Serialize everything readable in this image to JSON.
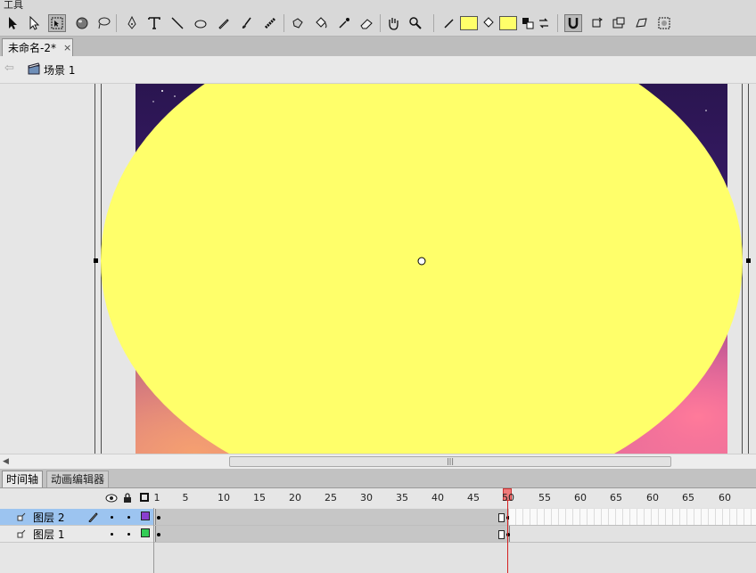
{
  "toolbar": {
    "title": "工具",
    "tools": [
      {
        "name": "selection-tool",
        "icon": "arrow-icon"
      },
      {
        "name": "subselection-tool",
        "icon": "white-arrow-icon"
      },
      {
        "name": "free-transform-tool",
        "icon": "free-transform-icon"
      },
      {
        "name": "3d-rotation-tool",
        "icon": "sphere-icon"
      },
      {
        "name": "lasso-tool",
        "icon": "lasso-icon"
      },
      {
        "name": "pen-tool",
        "icon": "pen-icon"
      },
      {
        "name": "text-tool",
        "icon": "text-icon"
      },
      {
        "name": "line-tool",
        "icon": "line-icon"
      },
      {
        "name": "oval-tool",
        "icon": "oval-icon"
      },
      {
        "name": "pencil-tool",
        "icon": "pencil-icon"
      },
      {
        "name": "brush-tool",
        "icon": "brush-icon"
      },
      {
        "name": "deco-tool",
        "icon": "deco-icon"
      },
      {
        "name": "bone-tool",
        "icon": "bone-icon"
      },
      {
        "name": "paint-bucket-tool",
        "icon": "bucket-icon"
      },
      {
        "name": "eyedropper-tool",
        "icon": "eyedropper-icon"
      },
      {
        "name": "eraser-tool",
        "icon": "eraser-icon"
      },
      {
        "name": "hand-tool",
        "icon": "hand-icon"
      },
      {
        "name": "zoom-tool",
        "icon": "magnifier-icon"
      }
    ],
    "stroke_color": "#ffff6a",
    "fill_color": "#ffff6a"
  },
  "document": {
    "tab_label": "未命名-2*",
    "close_label": "×"
  },
  "scene": {
    "label": "场景 1"
  },
  "stage": {
    "ellipse_fill": "#ffff6a",
    "canvas_top_color": "#2a1550"
  },
  "timeline": {
    "tabs": [
      {
        "label": "时间轴"
      },
      {
        "label": "动画编辑器"
      }
    ],
    "ruler": [
      "1",
      "5",
      "10",
      "15",
      "20",
      "25",
      "30",
      "35",
      "40",
      "45",
      "50",
      "55",
      "60",
      "65",
      "60",
      "65",
      "60"
    ],
    "current_frame": 50,
    "layers": [
      {
        "name": "图层 2",
        "selected": true,
        "color": "#8a3fd0"
      },
      {
        "name": "图层 1",
        "selected": false,
        "color": "#33cc55"
      }
    ]
  }
}
